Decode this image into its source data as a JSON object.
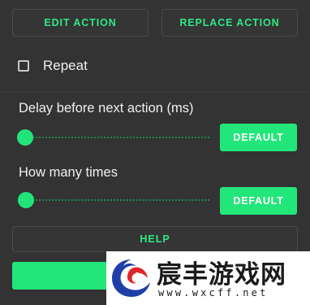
{
  "toolbar": {
    "edit_label": "EDIT ACTION",
    "replace_label": "REPLACE ACTION"
  },
  "repeat": {
    "label": "Repeat",
    "checked": false
  },
  "delay": {
    "label": "Delay before next action (ms)",
    "slider_fraction": 0.0,
    "default_label": "DEFAULT"
  },
  "times": {
    "label": "How many times",
    "slider_fraction": 0.0,
    "default_label": "DEFAULT"
  },
  "help": {
    "label": "HELP"
  },
  "watermark": {
    "title": "宸丰游戏网",
    "url": "www.wxcff.net"
  },
  "colors": {
    "background": "#333333",
    "accent": "#22e67a",
    "accent_text": "#2ee886",
    "button_border": "#4a4a4a"
  },
  "icons": {
    "checkbox": "checkbox-unchecked-icon",
    "watermark_logo": "dragon-logo-icon"
  }
}
